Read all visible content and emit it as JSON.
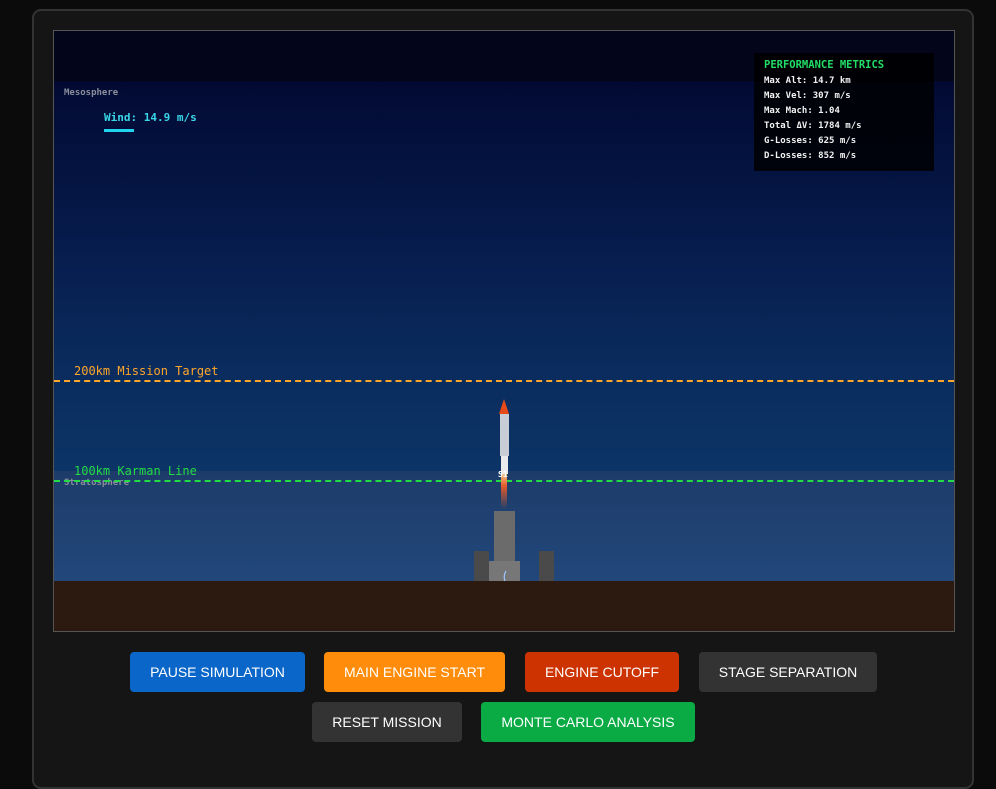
{
  "scene": {
    "layers": {
      "mesosphere": "Mesosphere",
      "stratosphere": "Stratosphere"
    },
    "wind_label": "Wind: 14.9 m/s",
    "target_line": {
      "label": "200km Mission Target",
      "color": "#ffa62b"
    },
    "karman_line": {
      "label": "100km Karman Line",
      "color": "#22dd44"
    },
    "stage_label": "S1"
  },
  "metrics": {
    "title": "PERFORMANCE METRICS",
    "rows": [
      "Max Alt: 14.7 km",
      "Max Vel: 307 m/s",
      "Max Mach: 1.04",
      "Total ΔV: 1784 m/s",
      "G-Losses: 625 m/s",
      "D-Losses: 852 m/s"
    ]
  },
  "controls": {
    "pause": {
      "label": "PAUSE SIMULATION",
      "color": "#0a66c8"
    },
    "main_engine": {
      "label": "MAIN ENGINE START",
      "color": "#ff8c0a"
    },
    "cutoff": {
      "label": "ENGINE CUTOFF",
      "color": "#cc3300"
    },
    "separation": {
      "label": "STAGE SEPARATION",
      "color": "#333333"
    },
    "reset": {
      "label": "RESET MISSION",
      "color": "#333333"
    },
    "monte_carlo": {
      "label": "MONTE CARLO ANALYSIS",
      "color": "#0aaa44"
    }
  }
}
